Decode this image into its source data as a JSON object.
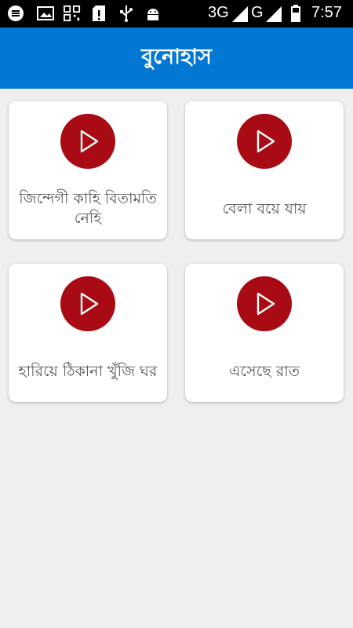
{
  "status_bar": {
    "network_3g": "3G",
    "network_g": "G",
    "time": "7:57"
  },
  "header": {
    "title": "বুনোহাস"
  },
  "songs": [
    {
      "title": "জিন্দেগী কাহি বিতামতি নেহি"
    },
    {
      "title": "বেলা বয়ে যায়"
    },
    {
      "title": "হারিয়ে ঠিকানা খুঁজি ঘর"
    },
    {
      "title": "এসেছে রাত"
    }
  ],
  "colors": {
    "app_bar": "#0277d4",
    "play_button": "#a80b13",
    "background": "#efefef"
  }
}
